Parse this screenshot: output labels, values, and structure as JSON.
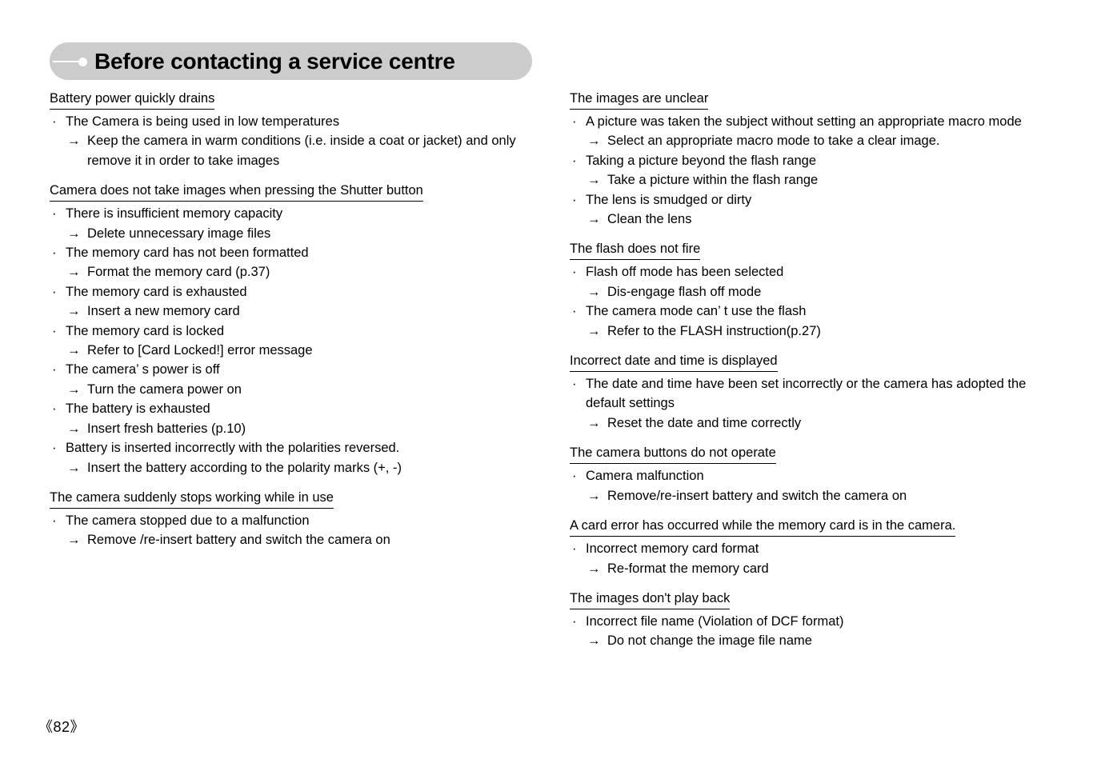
{
  "header": {
    "title": "Before contacting a service centre",
    "marker_icon": "line-dot-marker-icon"
  },
  "footer": {
    "page_number": "《82》"
  },
  "columns": {
    "left": [
      {
        "heading": "Battery power quickly drains",
        "items": [
          {
            "marker": "·",
            "text": "The Camera is being used in low temperatures",
            "type": "cause"
          },
          {
            "marker": "→",
            "text": "Keep the camera in warm conditions (i.e. inside a coat or jacket) and only remove it in order to take images",
            "type": "remedy"
          }
        ]
      },
      {
        "heading": "Camera does not take images when pressing the Shutter button",
        "items": [
          {
            "marker": "·",
            "text": "There is insufficient memory capacity",
            "type": "cause"
          },
          {
            "marker": "→",
            "text": "Delete unnecessary image files",
            "type": "remedy"
          },
          {
            "marker": "·",
            "text": "The memory card has not been formatted",
            "type": "cause"
          },
          {
            "marker": "→",
            "text": "Format the memory card (p.37)",
            "type": "remedy"
          },
          {
            "marker": "·",
            "text": "The memory card is exhausted",
            "type": "cause"
          },
          {
            "marker": "→",
            "text": "Insert a new memory card",
            "type": "remedy"
          },
          {
            "marker": "·",
            "text": "The memory card is locked",
            "type": "cause"
          },
          {
            "marker": "→",
            "text": "Refer to [Card Locked!] error message",
            "type": "remedy"
          },
          {
            "marker": "·",
            "text": "The camera’ s power is off",
            "type": "cause"
          },
          {
            "marker": "→",
            "text": "Turn the camera power on",
            "type": "remedy"
          },
          {
            "marker": "·",
            "text": "The battery is exhausted",
            "type": "cause"
          },
          {
            "marker": "→",
            "text": "Insert fresh batteries (p.10)",
            "type": "remedy"
          },
          {
            "marker": "·",
            "text": "Battery is inserted incorrectly with the polarities reversed.",
            "type": "cause"
          },
          {
            "marker": "→",
            "text": "Insert the battery according to the polarity marks (+, -)",
            "type": "remedy"
          }
        ]
      },
      {
        "heading": "The camera suddenly stops working while in use",
        "items": [
          {
            "marker": "·",
            "text": "The camera stopped due to a malfunction",
            "type": "cause"
          },
          {
            "marker": "→",
            "text": "Remove /re-insert battery and switch the camera on",
            "type": "remedy"
          }
        ]
      }
    ],
    "right": [
      {
        "heading": "The images are unclear",
        "items": [
          {
            "marker": "·",
            "text": "A picture was taken the subject without setting an appropriate macro mode",
            "type": "cause"
          },
          {
            "marker": "→",
            "text": "Select an appropriate macro mode to take a clear image.",
            "type": "remedy"
          },
          {
            "marker": "·",
            "text": "Taking a picture beyond the flash range",
            "type": "cause"
          },
          {
            "marker": "→",
            "text": "Take a picture within the flash range",
            "type": "remedy"
          },
          {
            "marker": "·",
            "text": "The lens is smudged or dirty",
            "type": "cause"
          },
          {
            "marker": "→",
            "text": "Clean the lens",
            "type": "remedy"
          }
        ]
      },
      {
        "heading": "The flash does not fire",
        "items": [
          {
            "marker": "·",
            "text": "Flash off mode has been selected",
            "type": "cause"
          },
          {
            "marker": "→",
            "text": "Dis-engage flash off mode",
            "type": "remedy"
          },
          {
            "marker": "·",
            "text": "The camera mode can’ t use the flash",
            "type": "cause"
          },
          {
            "marker": "→",
            "text": "Refer to the FLASH instruction(p.27)",
            "type": "remedy"
          }
        ]
      },
      {
        "heading": "Incorrect date and time is displayed",
        "items": [
          {
            "marker": "·",
            "text": "The date and time have been set incorrectly or the camera has adopted the default settings",
            "type": "cause"
          },
          {
            "marker": "→",
            "text": "Reset the date and time correctly",
            "type": "remedy"
          }
        ]
      },
      {
        "heading": "The camera buttons do not operate",
        "items": [
          {
            "marker": "·",
            "text": "Camera malfunction",
            "type": "cause"
          },
          {
            "marker": "→",
            "text": "Remove/re-insert battery and switch the camera on",
            "type": "remedy"
          }
        ]
      },
      {
        "heading": "A card error has occurred while the memory card is in the camera.",
        "items": [
          {
            "marker": "·",
            "text": "Incorrect memory card format",
            "type": "cause"
          },
          {
            "marker": "→",
            "text": "Re-format the memory card",
            "type": "remedy"
          }
        ]
      },
      {
        "heading": "The images don't play back",
        "items": [
          {
            "marker": "·",
            "text": "Incorrect file name (Violation of DCF format)",
            "type": "cause"
          },
          {
            "marker": "→",
            "text": "Do not change the image file name",
            "type": "remedy"
          }
        ]
      }
    ]
  }
}
